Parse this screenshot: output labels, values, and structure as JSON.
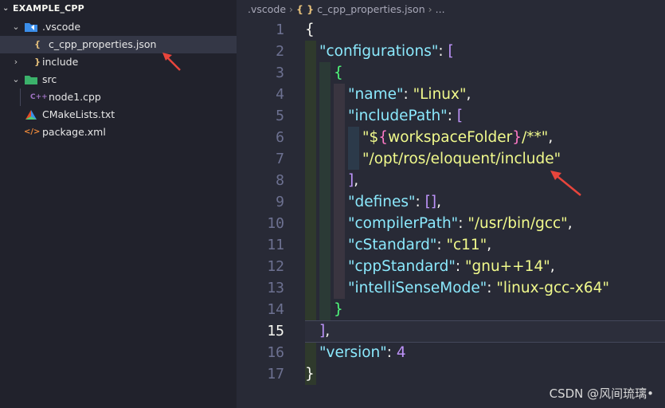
{
  "explorer": {
    "title": "EXAMPLE_CPP",
    "items": [
      {
        "label": ".vscode",
        "icon": "folder-vscode-icon",
        "expanded": true
      },
      {
        "label": "c_cpp_properties.json",
        "icon": "json-icon",
        "icon_text": "{ }"
      },
      {
        "label": "include",
        "icon": "folder-icon",
        "expanded": false
      },
      {
        "label": "src",
        "icon": "folder-src-icon",
        "expanded": true
      },
      {
        "label": "node1.cpp",
        "icon": "cpp-file-icon",
        "icon_text": "C++"
      },
      {
        "label": "CMakeLists.txt",
        "icon": "cmake-icon"
      },
      {
        "label": "package.xml",
        "icon": "xml-icon",
        "icon_text": "</>"
      }
    ]
  },
  "breadcrumb": {
    "folder": ".vscode",
    "file_icon_text": "{ }",
    "file": "c_cpp_properties.json",
    "more": "..."
  },
  "editor": {
    "line_numbers": [
      "1",
      "2",
      "3",
      "4",
      "5",
      "6",
      "7",
      "8",
      "9",
      "10",
      "11",
      "12",
      "13",
      "14",
      "15",
      "16",
      "17"
    ],
    "active_line": "15",
    "code": {
      "l1_open": "{",
      "l2_key": "\"configurations\"",
      "l2_colon": ": ",
      "l2_open": "[",
      "l3_open": "{",
      "l4_key": "\"name\"",
      "l4_colon": ": ",
      "l4_val": "\"Linux\"",
      "l4_comma": ",",
      "l5_key": "\"includePath\"",
      "l5_colon": ": ",
      "l5_open": "[",
      "l6_q1": "\"",
      "l6_dollar": "$",
      "l6_lbrace": "{",
      "l6_var": "workspaceFolder",
      "l6_rbrace": "}",
      "l6_rest": "/**\"",
      "l6_comma": ",",
      "l7_val": "\"/opt/ros/eloquent/include\"",
      "l8_close": "]",
      "l8_comma": ",",
      "l9_key": "\"defines\"",
      "l9_colon": ": ",
      "l9_val": "[]",
      "l9_comma": ",",
      "l10_key": "\"compilerPath\"",
      "l10_colon": ": ",
      "l10_val": "\"/usr/bin/gcc\"",
      "l10_comma": ",",
      "l11_key": "\"cStandard\"",
      "l11_colon": ": ",
      "l11_val": "\"c11\"",
      "l11_comma": ",",
      "l12_key": "\"cppStandard\"",
      "l12_colon": ": ",
      "l12_val": "\"gnu++14\"",
      "l12_comma": ",",
      "l13_key": "\"intelliSenseMode\"",
      "l13_colon": ": ",
      "l13_val": "\"linux-gcc-x64\"",
      "l14_close": "}",
      "l15_close": "]",
      "l15_comma": ",",
      "l16_key": "\"version\"",
      "l16_colon": ": ",
      "l16_val": "4",
      "l17_close": "}"
    }
  },
  "watermark": "CSDN @风间琉璃•",
  "colors": {
    "annotation_arrow": "#e8453c",
    "key": "#8be9fd",
    "string": "#f1fa8c",
    "number": "#bd93f9"
  }
}
